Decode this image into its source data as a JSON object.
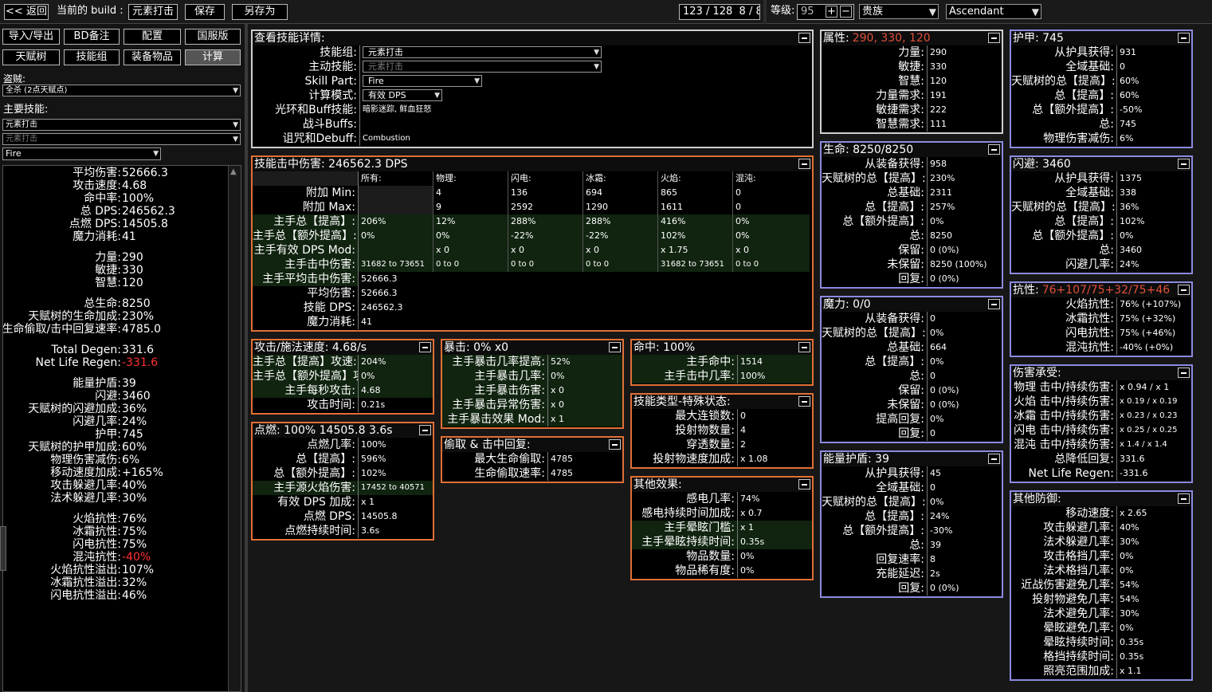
{
  "topbar": {
    "back": "<< 返回",
    "build_label": "当前的 build :",
    "build_name": "元素打击",
    "save": "保存",
    "save_as": "另存为",
    "points": "123 / 128",
    "ascend_points": "8 / 8",
    "level_label": "等级:",
    "level": "95",
    "class": "贵族",
    "ascendancy": "Ascendant"
  },
  "left": {
    "buttons": [
      "导入/导出",
      "BD备注",
      "配置",
      "国服版"
    ],
    "tabs": [
      "天赋树",
      "技能组",
      "装备物品",
      "计算"
    ],
    "bandit_label": "盗贼:",
    "bandit_value": "全杀 (2点天赋点)",
    "main_skill_label": "主要技能:",
    "main_skill_1": "元素打击",
    "main_skill_2": "元素打击",
    "skill_part": "Fire",
    "stats": [
      {
        "k": "平均伤害:",
        "v": "52666.3"
      },
      {
        "k": "攻击速度:",
        "v": "4.68"
      },
      {
        "k": "命中率:",
        "v": "100%"
      },
      {
        "k": "总 DPS:",
        "v": "246562.3"
      },
      {
        "k": "点燃 DPS:",
        "v": "14505.8"
      },
      {
        "k": "魔力消耗:",
        "v": "41"
      },
      {
        "k": "力量:",
        "v": "290"
      },
      {
        "k": "敏捷:",
        "v": "330"
      },
      {
        "k": "智慧:",
        "v": "120"
      },
      {
        "k": "总生命:",
        "v": "8250"
      },
      {
        "k": "天赋树的生命加成:",
        "v": "230%"
      },
      {
        "k": "生命偷取/击中回复速率:",
        "v": "4785.0"
      },
      {
        "k": "Total Degen:",
        "v": "331.6"
      },
      {
        "k": "Net Life Regen:",
        "v": "-331.6"
      },
      {
        "k": "能量护盾:",
        "v": "39"
      },
      {
        "k": "闪避:",
        "v": "3460"
      },
      {
        "k": "天赋树的闪避加成:",
        "v": "36%"
      },
      {
        "k": "闪避几率:",
        "v": "24%"
      },
      {
        "k": "护甲:",
        "v": "745"
      },
      {
        "k": "天赋树的护甲加成:",
        "v": "60%"
      },
      {
        "k": "物理伤害减伤:",
        "v": "6%"
      },
      {
        "k": "移动速度加成:",
        "v": "+165%"
      },
      {
        "k": "攻击躲避几率:",
        "v": "40%"
      },
      {
        "k": "法术躲避几率:",
        "v": "30%"
      },
      {
        "k": "火焰抗性:",
        "v": "76%"
      },
      {
        "k": "冰霜抗性:",
        "v": "75%"
      },
      {
        "k": "闪电抗性:",
        "v": "75%"
      },
      {
        "k": "混沌抗性:",
        "v": "-40%"
      },
      {
        "k": "火焰抗性溢出:",
        "v": "107%"
      },
      {
        "k": "冰霜抗性溢出:",
        "v": "32%"
      },
      {
        "k": "闪电抗性溢出:",
        "v": "46%"
      }
    ]
  },
  "skill_view": {
    "title": "查看技能详情:",
    "rows": [
      {
        "k": "技能组:",
        "v": "元素打击"
      },
      {
        "k": "主动技能:",
        "v": "元素打击"
      },
      {
        "k": "Skill Part:",
        "v": "Fire"
      },
      {
        "k": "计算模式:",
        "v": "有效 DPS"
      },
      {
        "k": "光环和Buff技能:",
        "v": "暗影迷踪, 鲜血狂怒"
      },
      {
        "k": "战斗Buffs:",
        "v": ""
      },
      {
        "k": "诅咒和Debuff:",
        "v": "Combustion"
      }
    ]
  },
  "hit": {
    "title": "技能击中伤害: 246562.3 DPS",
    "cols": [
      "所有:",
      "物理:",
      "闪电:",
      "冰霜:",
      "火焰:",
      "混沌:"
    ],
    "rows": [
      {
        "k": "附加 Min:",
        "c": [
          "",
          "4",
          "136",
          "694",
          "865",
          "0"
        ]
      },
      {
        "k": "附加 Max:",
        "c": [
          "",
          "9",
          "2592",
          "1290",
          "1611",
          "0"
        ]
      },
      {
        "k": "主手总【提高】:",
        "c": [
          "206%",
          "12%",
          "288%",
          "288%",
          "416%",
          "0%"
        ]
      },
      {
        "k": "主手总【额外提高】:",
        "c": [
          "0%",
          "0%",
          "-22%",
          "-22%",
          "102%",
          "0%"
        ]
      },
      {
        "k": "主手有效 DPS Mod:",
        "c": [
          "",
          "x 0",
          "x 0",
          "x 0",
          "x 1.75",
          "x 0"
        ]
      },
      {
        "k": "主手击中伤害:",
        "c": [
          "31682 to 73651",
          "0 to 0",
          "0 to 0",
          "0 to 0",
          "31682 to 73651",
          "0 to 0"
        ]
      }
    ],
    "single": [
      {
        "k": "主手平均击中伤害:",
        "v": "52666.3"
      },
      {
        "k": "平均伤害:",
        "v": "52666.3"
      },
      {
        "k": "技能 DPS:",
        "v": "246562.3"
      },
      {
        "k": "魔力消耗:",
        "v": "41"
      }
    ]
  },
  "speed": {
    "title": "攻击/施法速度: 4.68/s",
    "rows": [
      {
        "k": "主手总【提高】攻速:",
        "v": "204%"
      },
      {
        "k": "主手总【额外提高】攻速:",
        "v": "0%"
      },
      {
        "k": "主手每秒攻击:",
        "v": "4.68"
      },
      {
        "k": "攻击时间:",
        "v": "0.21s"
      }
    ]
  },
  "ignite": {
    "title": "点燃: 100% 14505.8 3.6s",
    "rows": [
      {
        "k": "点燃几率:",
        "v": "100%"
      },
      {
        "k": "总【提高】:",
        "v": "596%"
      },
      {
        "k": "总【额外提高】:",
        "v": "102%"
      },
      {
        "k": "主手源火焰伤害:",
        "v": "17452 to 40571"
      },
      {
        "k": "有效 DPS 加成:",
        "v": "x 1"
      },
      {
        "k": "点燃 DPS:",
        "v": "14505.8"
      },
      {
        "k": "点燃持续时间:",
        "v": "3.6s"
      }
    ]
  },
  "crit": {
    "title": "暴击: 0% x0",
    "rows": [
      {
        "k": "主手暴击几率提高:",
        "v": "52%"
      },
      {
        "k": "主手暴击几率:",
        "v": "0%"
      },
      {
        "k": "主手暴击伤害:",
        "v": "x 0"
      },
      {
        "k": "主手暴击异常伤害:",
        "v": "x 0"
      },
      {
        "k": "主手暴击效果 Mod:",
        "v": "x 1"
      }
    ]
  },
  "leech": {
    "title": "偷取 & 击中回复:",
    "rows": [
      {
        "k": "最大生命偷取:",
        "v": "4785"
      },
      {
        "k": "生命偷取速率:",
        "v": "4785"
      }
    ]
  },
  "hitchance": {
    "title": "命中: 100%",
    "rows": [
      {
        "k": "主手命中:",
        "v": "1514"
      },
      {
        "k": "主手击中几率:",
        "v": "100%"
      }
    ]
  },
  "skilltype": {
    "title": "技能类型-特殊状态:",
    "rows": [
      {
        "k": "最大连锁数:",
        "v": "0"
      },
      {
        "k": "投射物数量:",
        "v": "4"
      },
      {
        "k": "穿透数量:",
        "v": "2"
      },
      {
        "k": "投射物速度加成:",
        "v": "x 1.08"
      }
    ]
  },
  "other": {
    "title": "其他效果:",
    "rows": [
      {
        "k": "感电几率:",
        "v": "74%"
      },
      {
        "k": "感电持续时间加成:",
        "v": "x 0.7"
      },
      {
        "k": "主手晕眩门槛:",
        "v": "x 1"
      },
      {
        "k": "主手晕眩持续时间:",
        "v": "0.35s"
      },
      {
        "k": "物品数量:",
        "v": "0%"
      },
      {
        "k": "物品稀有度:",
        "v": "0%"
      }
    ]
  },
  "attr": {
    "title": "属性:",
    "title_val": "290, 330, 120",
    "rows": [
      {
        "k": "力量:",
        "v": "290"
      },
      {
        "k": "敏捷:",
        "v": "330"
      },
      {
        "k": "智慧:",
        "v": "120"
      },
      {
        "k": "力量需求:",
        "v": "191"
      },
      {
        "k": "敏捷需求:",
        "v": "222"
      },
      {
        "k": "智慧需求:",
        "v": "111"
      }
    ]
  },
  "life": {
    "title": "生命: 8250/8250",
    "rows": [
      {
        "k": "从装备获得:",
        "v": "958"
      },
      {
        "k": "天赋树的总【提高】:",
        "v": "230%"
      },
      {
        "k": "总基础:",
        "v": "2311"
      },
      {
        "k": "总【提高】:",
        "v": "257%"
      },
      {
        "k": "总【额外提高】:",
        "v": "0%"
      },
      {
        "k": "总:",
        "v": "8250"
      },
      {
        "k": "保留:",
        "v": "0 (0%)"
      },
      {
        "k": "未保留:",
        "v": "8250 (100%)"
      },
      {
        "k": "回复:",
        "v": "0 (0%)"
      }
    ]
  },
  "mana": {
    "title": "魔力: 0/0",
    "rows": [
      {
        "k": "从装备获得:",
        "v": "0"
      },
      {
        "k": "天赋树的总【提高】:",
        "v": "0%"
      },
      {
        "k": "总基础:",
        "v": "664"
      },
      {
        "k": "总【提高】:",
        "v": "0%"
      },
      {
        "k": "总:",
        "v": "0"
      },
      {
        "k": "保留:",
        "v": "0 (0%)"
      },
      {
        "k": "未保留:",
        "v": "0 (0%)"
      },
      {
        "k": "提高回复:",
        "v": "0%"
      },
      {
        "k": "回复:",
        "v": "0"
      }
    ]
  },
  "es": {
    "title": "能量护盾: 39",
    "rows": [
      {
        "k": "从护具获得:",
        "v": "45"
      },
      {
        "k": "全域基础:",
        "v": "0"
      },
      {
        "k": "天赋树的总【提高】:",
        "v": "0%"
      },
      {
        "k": "总【提高】:",
        "v": "24%"
      },
      {
        "k": "总【额外提高】:",
        "v": "-30%"
      },
      {
        "k": "总:",
        "v": "39"
      },
      {
        "k": "回复速率:",
        "v": "8"
      },
      {
        "k": "充能延迟:",
        "v": "2s"
      },
      {
        "k": "回复:",
        "v": "0 (0%)"
      }
    ]
  },
  "armour": {
    "title": "护甲: 745",
    "rows": [
      {
        "k": "从护具获得:",
        "v": "931"
      },
      {
        "k": "全域基础:",
        "v": "0"
      },
      {
        "k": "天赋树的总【提高】:",
        "v": "60%"
      },
      {
        "k": "总【提高】:",
        "v": "60%"
      },
      {
        "k": "总【额外提高】:",
        "v": "-50%"
      },
      {
        "k": "总:",
        "v": "745"
      },
      {
        "k": "物理伤害减伤:",
        "v": "6%"
      }
    ]
  },
  "evasion": {
    "title": "闪避: 3460",
    "rows": [
      {
        "k": "从护具获得:",
        "v": "1375"
      },
      {
        "k": "全域基础:",
        "v": "338"
      },
      {
        "k": "天赋树的总【提高】:",
        "v": "36%"
      },
      {
        "k": "总【提高】:",
        "v": "102%"
      },
      {
        "k": "总【额外提高】:",
        "v": "0%"
      },
      {
        "k": "总:",
        "v": "3460"
      },
      {
        "k": "闪避几率:",
        "v": "24%"
      }
    ]
  },
  "resist": {
    "title": "抗性:",
    "title_val": "76+107/75+32/75+46",
    "rows": [
      {
        "k": "火焰抗性:",
        "v": "76% (+107%)"
      },
      {
        "k": "冰霜抗性:",
        "v": "75% (+32%)"
      },
      {
        "k": "闪电抗性:",
        "v": "75% (+46%)"
      },
      {
        "k": "混沌抗性:",
        "v": "-40% (+0%)"
      }
    ]
  },
  "taken": {
    "title": "伤害承受:",
    "rows": [
      {
        "k": "物理 击中/持续伤害:",
        "v": "x 0.94 / x 1"
      },
      {
        "k": "火焰 击中/持续伤害:",
        "v": "x 0.19 / x 0.19"
      },
      {
        "k": "冰霜 击中/持续伤害:",
        "v": "x 0.23 / x 0.23"
      },
      {
        "k": "闪电 击中/持续伤害:",
        "v": "x 0.25 / x 0.25"
      },
      {
        "k": "混沌 击中/持续伤害:",
        "v": "x 1.4 / x 1.4"
      },
      {
        "k": "总降低回复:",
        "v": "331.6"
      },
      {
        "k": "Net Life Regen:",
        "v": "-331.6"
      }
    ]
  },
  "otherdef": {
    "title": "其他防御:",
    "rows": [
      {
        "k": "移动速度:",
        "v": "x 2.65"
      },
      {
        "k": "攻击躲避几率:",
        "v": "40%"
      },
      {
        "k": "法术躲避几率:",
        "v": "30%"
      },
      {
        "k": "攻击格挡几率:",
        "v": "0%"
      },
      {
        "k": "法术格挡几率:",
        "v": "0%"
      },
      {
        "k": "近战伤害避免几率:",
        "v": "54%"
      },
      {
        "k": "投射物避免几率:",
        "v": "54%"
      },
      {
        "k": "法术避免几率:",
        "v": "30%"
      },
      {
        "k": "晕眩避免几率:",
        "v": "0%"
      },
      {
        "k": "晕眩持续时间:",
        "v": "0.35s"
      },
      {
        "k": "格挡持续时间:",
        "v": "0.35s"
      },
      {
        "k": "照亮范围加成:",
        "v": "x 1.1"
      }
    ]
  },
  "colors": {
    "accent_orange": "#e07035",
    "accent_purple": "#8b8be0",
    "negative": "#ff3030"
  }
}
